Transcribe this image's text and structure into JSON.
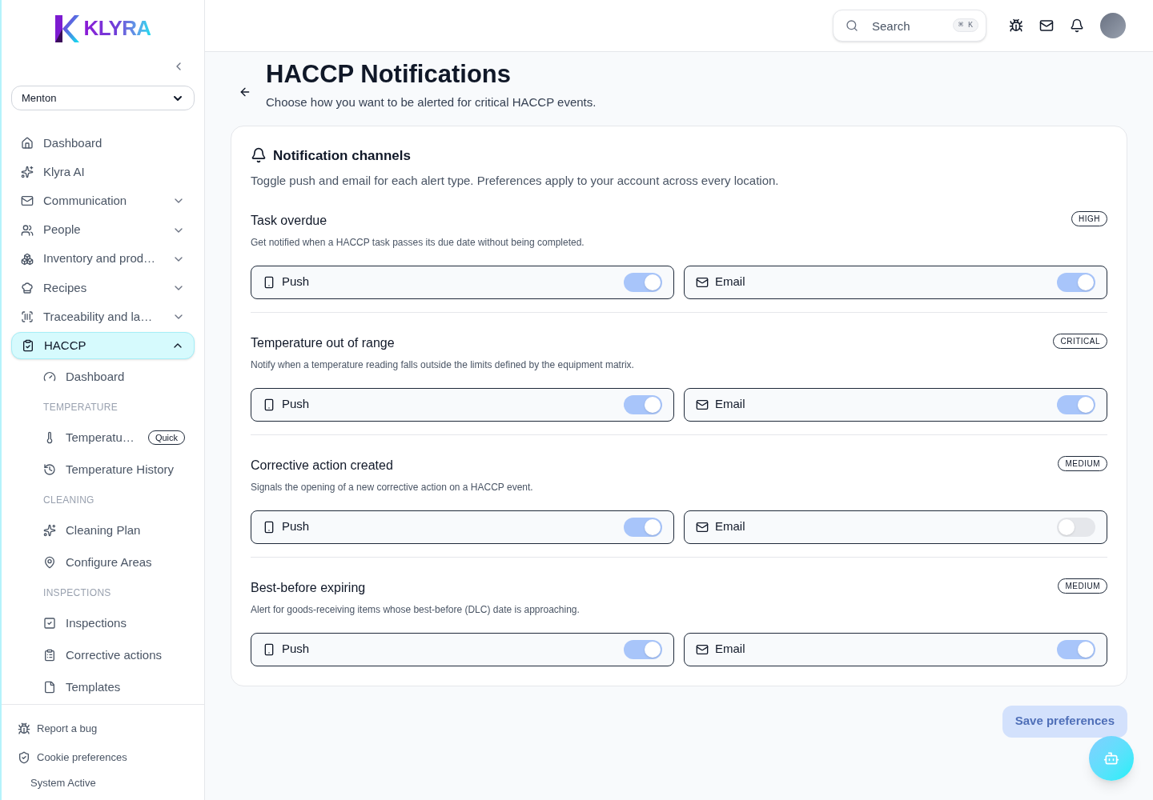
{
  "sidebar": {
    "logo": "KLYRA",
    "location": {
      "value": "Menton"
    },
    "nav": [
      {
        "kind": "link",
        "label": "Dashboard",
        "selected": false
      },
      {
        "kind": "link",
        "label": "Klyra AI",
        "selected": false
      },
      {
        "kind": "group",
        "label": "Communication",
        "expanded": false,
        "selected": false
      },
      {
        "kind": "group",
        "label": "People",
        "expanded": false,
        "selected": false
      },
      {
        "kind": "group",
        "label": "Inventory and prod…",
        "expanded": false,
        "selected": false
      },
      {
        "kind": "group",
        "label": "Recipes",
        "expanded": false,
        "selected": false
      },
      {
        "kind": "group",
        "label": "Traceability and la…",
        "expanded": false,
        "selected": false
      },
      {
        "kind": "group",
        "label": "HACCP",
        "expanded": true,
        "selected": true,
        "children": [
          {
            "kind": "link",
            "label": "Dashboard"
          },
          {
            "kind": "heading",
            "label": "TEMPERATURE"
          },
          {
            "kind": "link",
            "label": "Temperatu…",
            "badge": "Quick"
          },
          {
            "kind": "link",
            "label": "Temperature History"
          },
          {
            "kind": "heading",
            "label": "CLEANING"
          },
          {
            "kind": "link",
            "label": "Cleaning Plan"
          },
          {
            "kind": "link",
            "label": "Configure Areas"
          },
          {
            "kind": "heading",
            "label": "INSPECTIONS"
          },
          {
            "kind": "link",
            "label": "Inspections"
          },
          {
            "kind": "link",
            "label": "Corrective actions"
          },
          {
            "kind": "link",
            "label": "Templates"
          }
        ]
      }
    ],
    "footer": [
      {
        "label": "Report a bug"
      },
      {
        "label": "Cookie preferences"
      }
    ],
    "status": "System Active"
  },
  "header": {
    "search": {
      "placeholder": "Search",
      "shortcut": "⌘ K"
    }
  },
  "page": {
    "title": "HACCP Notifications",
    "subtitle": "Choose how you want to be alerted for critical HACCP events."
  },
  "card": {
    "title": "Notification channels",
    "description": "Toggle push and email for each alert type. Preferences apply to your account across every location.",
    "alerts": [
      {
        "title": "Task overdue",
        "severity": "HIGH",
        "description": "Get notified when a HACCP task passes its due date without being completed.",
        "channels": [
          {
            "kind": "push",
            "label": "Push",
            "on": true
          },
          {
            "kind": "email",
            "label": "Email",
            "on": true
          }
        ]
      },
      {
        "title": "Temperature out of range",
        "severity": "CRITICAL",
        "description": "Notify when a temperature reading falls outside the limits defined by the equipment matrix.",
        "channels": [
          {
            "kind": "push",
            "label": "Push",
            "on": true
          },
          {
            "kind": "email",
            "label": "Email",
            "on": true
          }
        ]
      },
      {
        "title": "Corrective action created",
        "severity": "MEDIUM",
        "description": "Signals the opening of a new corrective action on a HACCP event.",
        "channels": [
          {
            "kind": "push",
            "label": "Push",
            "on": true
          },
          {
            "kind": "email",
            "label": "Email",
            "on": false
          }
        ]
      },
      {
        "title": "Best-before expiring",
        "severity": "MEDIUM",
        "description": "Alert for goods-receiving items whose best-before (DLC) date is approaching.",
        "channels": [
          {
            "kind": "push",
            "label": "Push",
            "on": true
          },
          {
            "kind": "email",
            "label": "Email",
            "on": true
          }
        ]
      }
    ]
  },
  "save_button": {
    "label": "Save preferences",
    "disabled": true
  }
}
